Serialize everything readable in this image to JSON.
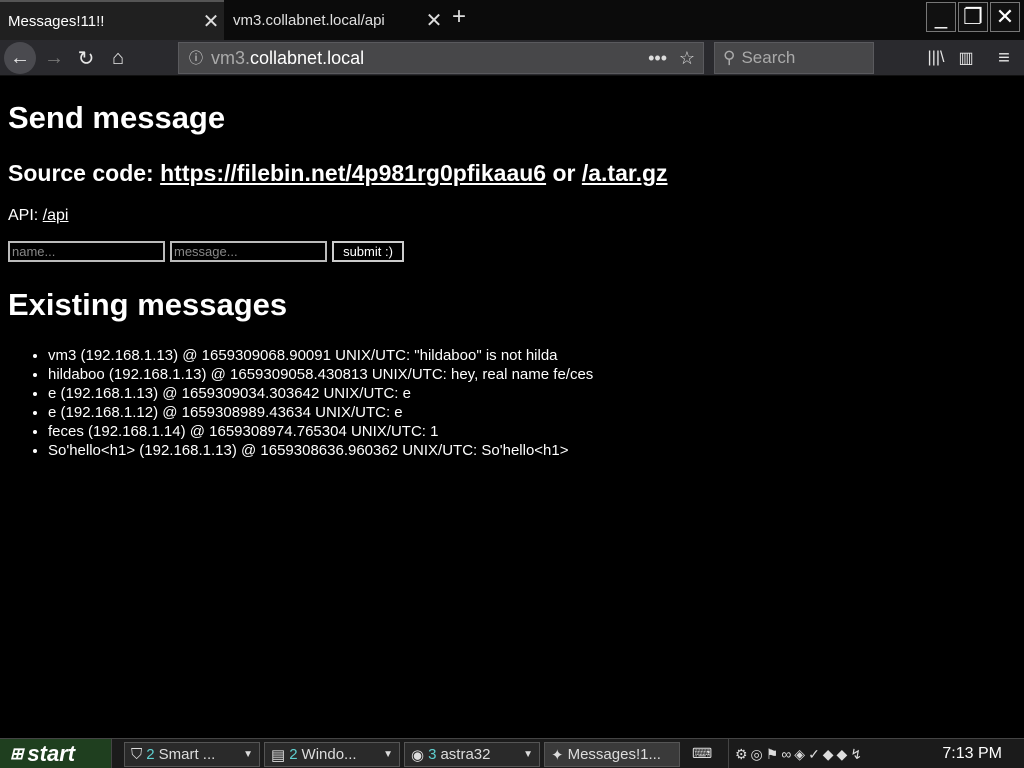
{
  "browser": {
    "tabs": [
      {
        "title": "Messages!11!!",
        "active": true
      },
      {
        "title": "vm3.collabnet.local/api",
        "active": false
      }
    ],
    "url_prefix": "vm3.",
    "url_host": "collabnet.local",
    "search_placeholder": "Search"
  },
  "page": {
    "title": "Send message",
    "source_label": "Source code:",
    "source_link": "https://filebin.net/4p981rg0pfikaau6",
    "source_or": "or",
    "source_tar": "/a.tar.gz",
    "api_label": "API:",
    "api_link": "/api",
    "form": {
      "name_placeholder": "name...",
      "message_placeholder": "message...",
      "submit_label": "submit :)"
    },
    "existing_title": "Existing messages",
    "messages": [
      "vm3 (192.168.1.13) @ 1659309068.90091 UNIX/UTC: \"hildaboo\" is not hilda",
      "hildaboo (192.168.1.13) @ 1659309058.430813 UNIX/UTC: hey, real name fe/ces",
      "e (192.168.1.13) @ 1659309034.303642 UNIX/UTC: e",
      "e (192.168.1.12) @ 1659308989.43634 UNIX/UTC: e",
      "feces (192.168.1.14) @ 1659308974.765304 UNIX/UTC: 1",
      "So'hello<h1> (192.168.1.13) @ 1659308636.960362 UNIX/UTC: So'hello<h1>"
    ]
  },
  "taskbar": {
    "start_label": "start",
    "tasks": [
      {
        "count": "2",
        "label": "Smart ..."
      },
      {
        "count": "2",
        "label": "Windo..."
      },
      {
        "count": "3",
        "label": "astra32"
      },
      {
        "count": "",
        "label": "Messages!1..."
      }
    ],
    "clock": "7:13 PM"
  }
}
